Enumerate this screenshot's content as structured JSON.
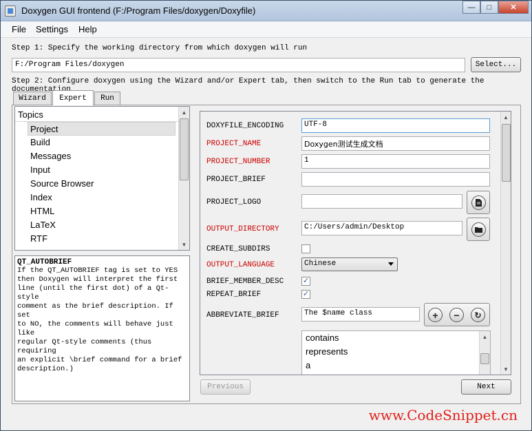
{
  "window": {
    "title": "Doxygen GUI frontend (F:/Program Files/doxygen/Doxyfile)"
  },
  "menu": {
    "file": "File",
    "settings": "Settings",
    "help": "Help"
  },
  "step1": {
    "text": "Step 1: Specify the working directory from which doxygen will run",
    "path": "F:/Program Files/doxygen",
    "select_label": "Select..."
  },
  "step2": {
    "text": "Step 2: Configure doxygen using the Wizard and/or Expert tab, then switch to the Run tab to generate the documentation"
  },
  "tabs": [
    {
      "label": "Wizard"
    },
    {
      "label": "Expert"
    },
    {
      "label": "Run"
    }
  ],
  "topics": {
    "header": "Topics",
    "items": [
      "Project",
      "Build",
      "Messages",
      "Input",
      "Source Browser",
      "Index",
      "HTML",
      "LaTeX",
      "RTF"
    ]
  },
  "help": {
    "title": "QT_AUTOBRIEF",
    "body": "If the QT_AUTOBRIEF tag is set to YES\nthen Doxygen will interpret the first\nline (until the first dot) of a Qt-style\ncomment as the brief description. If set\nto NO, the comments will behave just like\nregular Qt-style comments (thus requiring\nan explicit \\brief command for a brief\ndescription.)"
  },
  "options": {
    "doxyfile_encoding": {
      "label": "DOXYFILE_ENCODING",
      "value": "UTF-8"
    },
    "project_name": {
      "label": "PROJECT_NAME",
      "value": "Doxygen测试生成文档"
    },
    "project_number": {
      "label": "PROJECT_NUMBER",
      "value": "1"
    },
    "project_brief": {
      "label": "PROJECT_BRIEF",
      "value": ""
    },
    "project_logo": {
      "label": "PROJECT_LOGO",
      "value": ""
    },
    "output_directory": {
      "label": "OUTPUT_DIRECTORY",
      "value": "C:/Users/admin/Desktop"
    },
    "create_subdirs": {
      "label": "CREATE_SUBDIRS",
      "checked": false
    },
    "output_language": {
      "label": "OUTPUT_LANGUAGE",
      "value": "Chinese"
    },
    "brief_member_desc": {
      "label": "BRIEF_MEMBER_DESC",
      "checked": true
    },
    "repeat_brief": {
      "label": "REPEAT_BRIEF",
      "checked": true
    },
    "abbreviate_brief": {
      "label": "ABBREVIATE_BRIEF",
      "value": "The $name class",
      "list": [
        "contains",
        "represents",
        "a"
      ]
    }
  },
  "nav": {
    "previous": "Previous",
    "next": "Next"
  },
  "watermark": "www.CodeSnippet.cn",
  "colors": {
    "required_label": "#cc0000",
    "watermark": "#e0201a"
  },
  "icons": [
    "file-icon",
    "folder-icon",
    "add-icon",
    "remove-icon",
    "refresh-icon"
  ]
}
